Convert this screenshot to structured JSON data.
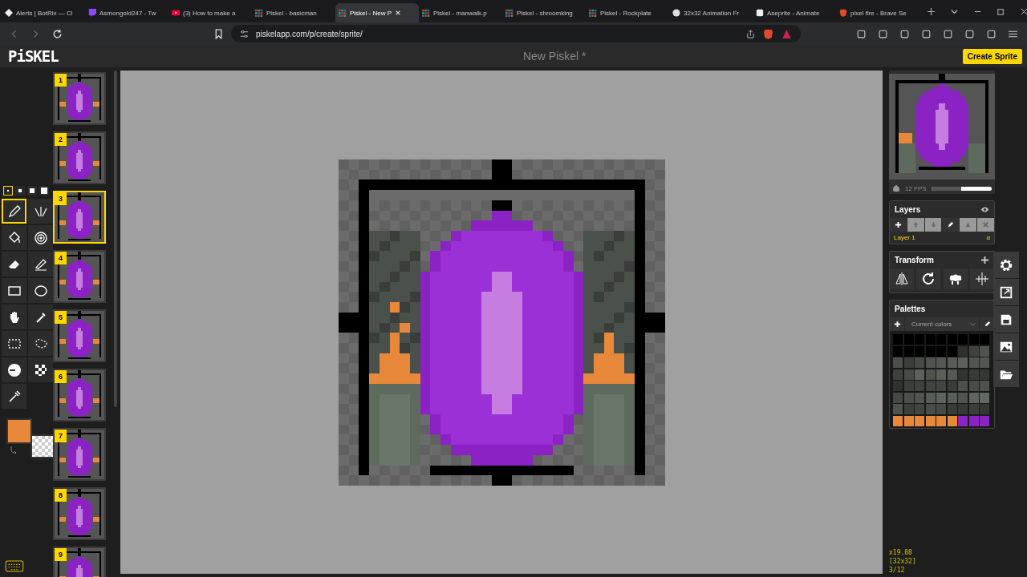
{
  "browser": {
    "tabs": [
      {
        "title": "Alerts | BotRix — Cl",
        "kind": "botrix",
        "selected": false
      },
      {
        "title": "Asmongold247 - Tw",
        "kind": "twitch",
        "selected": false
      },
      {
        "title": "(3) How to make a",
        "kind": "youtube",
        "selected": false
      },
      {
        "title": "Piskel - basicman",
        "kind": "piskel",
        "selected": false
      },
      {
        "title": "Piskel - New P",
        "kind": "piskel",
        "selected": true
      },
      {
        "title": "Piskel - manwalk.p",
        "kind": "piskel",
        "selected": false
      },
      {
        "title": "Piskel - shroomking",
        "kind": "piskel",
        "selected": false
      },
      {
        "title": "Piskel - Rockplate",
        "kind": "piskel",
        "selected": false
      },
      {
        "title": "32x32 Animation Fr",
        "kind": "openai",
        "selected": false
      },
      {
        "title": "Aseprite - Animate",
        "kind": "aseprite",
        "selected": false
      },
      {
        "title": "pixel fire - Brave Se",
        "kind": "brave",
        "selected": false
      }
    ],
    "address": "piskelapp.com/p/create/sprite/"
  },
  "app": {
    "logo": "PiSKEL",
    "title": "New Piskel *",
    "create_button": "Create Sprite"
  },
  "pen_sizes": [
    {
      "selected": true
    },
    {
      "selected": false
    },
    {
      "selected": false
    },
    {
      "selected": false
    }
  ],
  "tools": [
    {
      "kind": "pen",
      "selected": true
    },
    {
      "kind": "mirror",
      "selected": false
    },
    {
      "kind": "bucket",
      "selected": false
    },
    {
      "kind": "paint-same",
      "selected": false
    },
    {
      "kind": "eraser",
      "selected": false
    },
    {
      "kind": "stroke",
      "selected": false
    },
    {
      "kind": "rectangle",
      "selected": false
    },
    {
      "kind": "circle",
      "selected": false
    },
    {
      "kind": "move",
      "selected": false
    },
    {
      "kind": "shape-select",
      "selected": false
    },
    {
      "kind": "rect-select",
      "selected": false
    },
    {
      "kind": "lasso",
      "selected": false
    },
    {
      "kind": "lighten",
      "selected": false
    },
    {
      "kind": "dither",
      "selected": false
    },
    {
      "kind": "picker",
      "selected": false
    }
  ],
  "colors": {
    "primary": {
      "color": "#e8883a"
    }
  },
  "frames": [
    {
      "number": "1",
      "selected": false
    },
    {
      "number": "2",
      "selected": false
    },
    {
      "number": "3",
      "selected": true
    },
    {
      "number": "4",
      "selected": false
    },
    {
      "number": "5",
      "selected": false
    },
    {
      "number": "6",
      "selected": false
    },
    {
      "number": "7",
      "selected": false
    },
    {
      "number": "8",
      "selected": false
    },
    {
      "number": "9",
      "selected": false
    }
  ],
  "preview": {
    "fps": "12 FPS",
    "level": 0.5
  },
  "layers": {
    "title": "Layers",
    "items": [
      {
        "name": "Layer 1",
        "opacity": "α",
        "selected": true
      }
    ]
  },
  "transform": {
    "title": "Transform"
  },
  "palettes": {
    "title": "Palettes",
    "current": "Current colors",
    "swatches": [
      {
        "color": "#000000"
      },
      {
        "color": "#000000"
      },
      {
        "color": "#000000"
      },
      {
        "color": "#000000"
      },
      {
        "color": "#000000"
      },
      {
        "color": "#000000"
      },
      {
        "color": "#000000"
      },
      {
        "color": "#000000"
      },
      {
        "color": "#000000"
      },
      {
        "color": "#000000"
      },
      {
        "color": "#000000"
      },
      {
        "color": "#000000"
      },
      {
        "color": "#000000"
      },
      {
        "color": "#000000"
      },
      {
        "color": "#000000"
      },
      {
        "color": "#2e302e"
      },
      {
        "color": "#3f433f"
      },
      {
        "color": "#4e544e"
      },
      {
        "color": "#4a5048"
      },
      {
        "color": "#3a3e3a"
      },
      {
        "color": "#454a45"
      },
      {
        "color": "#4e534e"
      },
      {
        "color": "#525852"
      },
      {
        "color": "#565c56"
      },
      {
        "color": "#5a605a"
      },
      {
        "color": "#4f554f"
      },
      {
        "color": "#505650"
      },
      {
        "color": "#3e423e"
      },
      {
        "color": "#464b46"
      },
      {
        "color": "#5b615b"
      },
      {
        "color": "#4d524d"
      },
      {
        "color": "#585e58"
      },
      {
        "color": "#535953"
      },
      {
        "color": "#303330"
      },
      {
        "color": "#373a37"
      },
      {
        "color": "#343734"
      },
      {
        "color": "#2f322f"
      },
      {
        "color": "#3b3f3b"
      },
      {
        "color": "#3d413d"
      },
      {
        "color": "#404440"
      },
      {
        "color": "#424642"
      },
      {
        "color": "#393d39"
      },
      {
        "color": "#4a4f4a"
      },
      {
        "color": "#474c47"
      },
      {
        "color": "#4c514c"
      },
      {
        "color": "#444944"
      },
      {
        "color": "#4b504b"
      },
      {
        "color": "#4f544f"
      },
      {
        "color": "#555b55"
      },
      {
        "color": "#5d635d"
      },
      {
        "color": "#575d57"
      },
      {
        "color": "#505550"
      },
      {
        "color": "#5e645e"
      },
      {
        "color": "#626862"
      },
      {
        "color": "#4d534d"
      },
      {
        "color": "#3c403c"
      },
      {
        "color": "#414541"
      },
      {
        "color": "#4a4e4a"
      },
      {
        "color": "#464a46"
      },
      {
        "color": "#383b38"
      },
      {
        "color": "#363a36"
      },
      {
        "color": "#3b3f3b"
      },
      {
        "color": "#333733"
      },
      {
        "color": "#e8883a"
      },
      {
        "color": "#e8883a"
      },
      {
        "color": "#e8883a"
      },
      {
        "color": "#e8883a"
      },
      {
        "color": "#e8883a"
      },
      {
        "color": "#e8883a"
      },
      {
        "color": "#8a22c4"
      },
      {
        "color": "#8a22c4"
      },
      {
        "color": "#8a22c4"
      }
    ]
  },
  "status": {
    "zoom": "x19.08",
    "size": "[32x32]",
    "frame": "3/12"
  }
}
